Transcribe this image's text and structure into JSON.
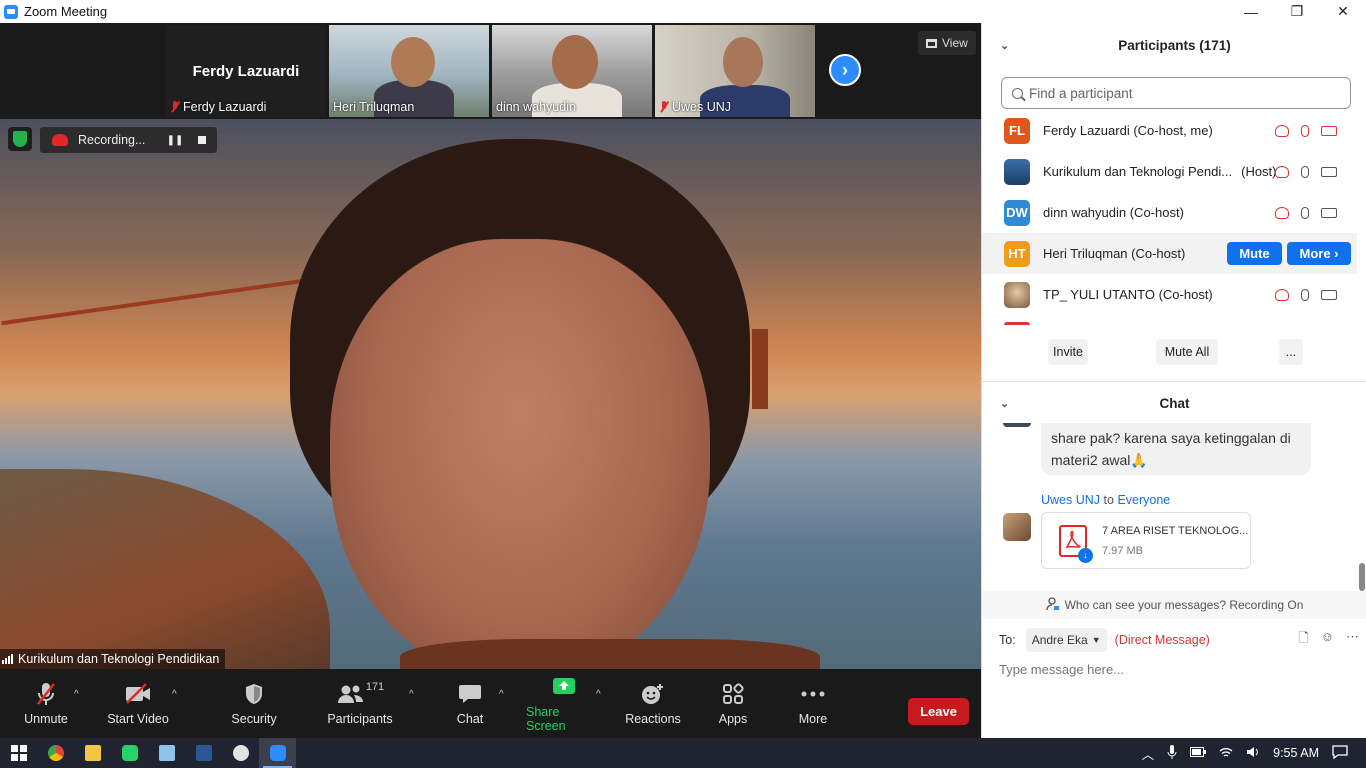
{
  "window": {
    "title": "Zoom Meeting",
    "minimize": "—",
    "restore": "❐",
    "close": "✕"
  },
  "gallery": {
    "self_big_name": "Ferdy Lazuardi",
    "tiles": [
      {
        "name": "Ferdy Lazuardi",
        "muted": true
      },
      {
        "name": "Heri Triluqman",
        "muted": false
      },
      {
        "name": "dinn wahyudin",
        "muted": false
      },
      {
        "name": "Uwes UNJ",
        "muted": true
      }
    ],
    "next_label": "›",
    "view_label": "View"
  },
  "recording": {
    "label": "Recording...",
    "pause": "❚❚"
  },
  "active_speaker": "Kurikulum dan Teknologi Pendidikan",
  "toolbar": {
    "unmute": "Unmute",
    "start_video": "Start Video",
    "security": "Security",
    "participants": "Participants",
    "participants_count": "171",
    "chat": "Chat",
    "share_screen": "Share Screen",
    "reactions": "Reactions",
    "apps": "Apps",
    "more": "More",
    "leave": "Leave",
    "caret": "^"
  },
  "participants_panel": {
    "title": "Participants (171)",
    "search_placeholder": "Find a participant",
    "rows": [
      {
        "initials": "FL",
        "color": "#e0571b",
        "name": "Ferdy Lazuardi (Co-host, me)"
      },
      {
        "initials": "",
        "color": "#2a5a8a",
        "name": "Kurikulum dan Teknologi Pendi...",
        "role": "(Host)"
      },
      {
        "initials": "DW",
        "color": "#2f8ad6",
        "name": "dinn wahyudin (Co-host)"
      },
      {
        "initials": "HT",
        "color": "#f29a1a",
        "name": "Heri Triluqman (Co-host)"
      },
      {
        "initials": "",
        "color": "#c9a27a",
        "name": "TP_ YULI UTANTO (Co-host)"
      }
    ],
    "mute_label": "Mute",
    "more_label": "More ›",
    "invite": "Invite",
    "mute_all": "Mute All",
    "ellipsis": "..."
  },
  "chat": {
    "title": "Chat",
    "bubble_text": "share pak? karena saya ketinggalan di materi2 awal🙏",
    "sender": "Uwes UNJ",
    "to_word": "to",
    "recipient": "Everyone",
    "file_name": "7 AREA RISET TEKNOLOG...",
    "file_size": "7.97 MB",
    "privacy": "Who can see your messages? Recording On",
    "to_label": "To:",
    "to_value": "Andre Eka",
    "direct_message": "(Direct Message)",
    "input_placeholder": "Type message here..."
  },
  "taskbar": {
    "time": "9:55 AM"
  },
  "colors": {
    "accent": "#2d8cff",
    "leave": "#c8191e",
    "share_green": "#23d160",
    "mute_blue": "#0e72ed"
  }
}
